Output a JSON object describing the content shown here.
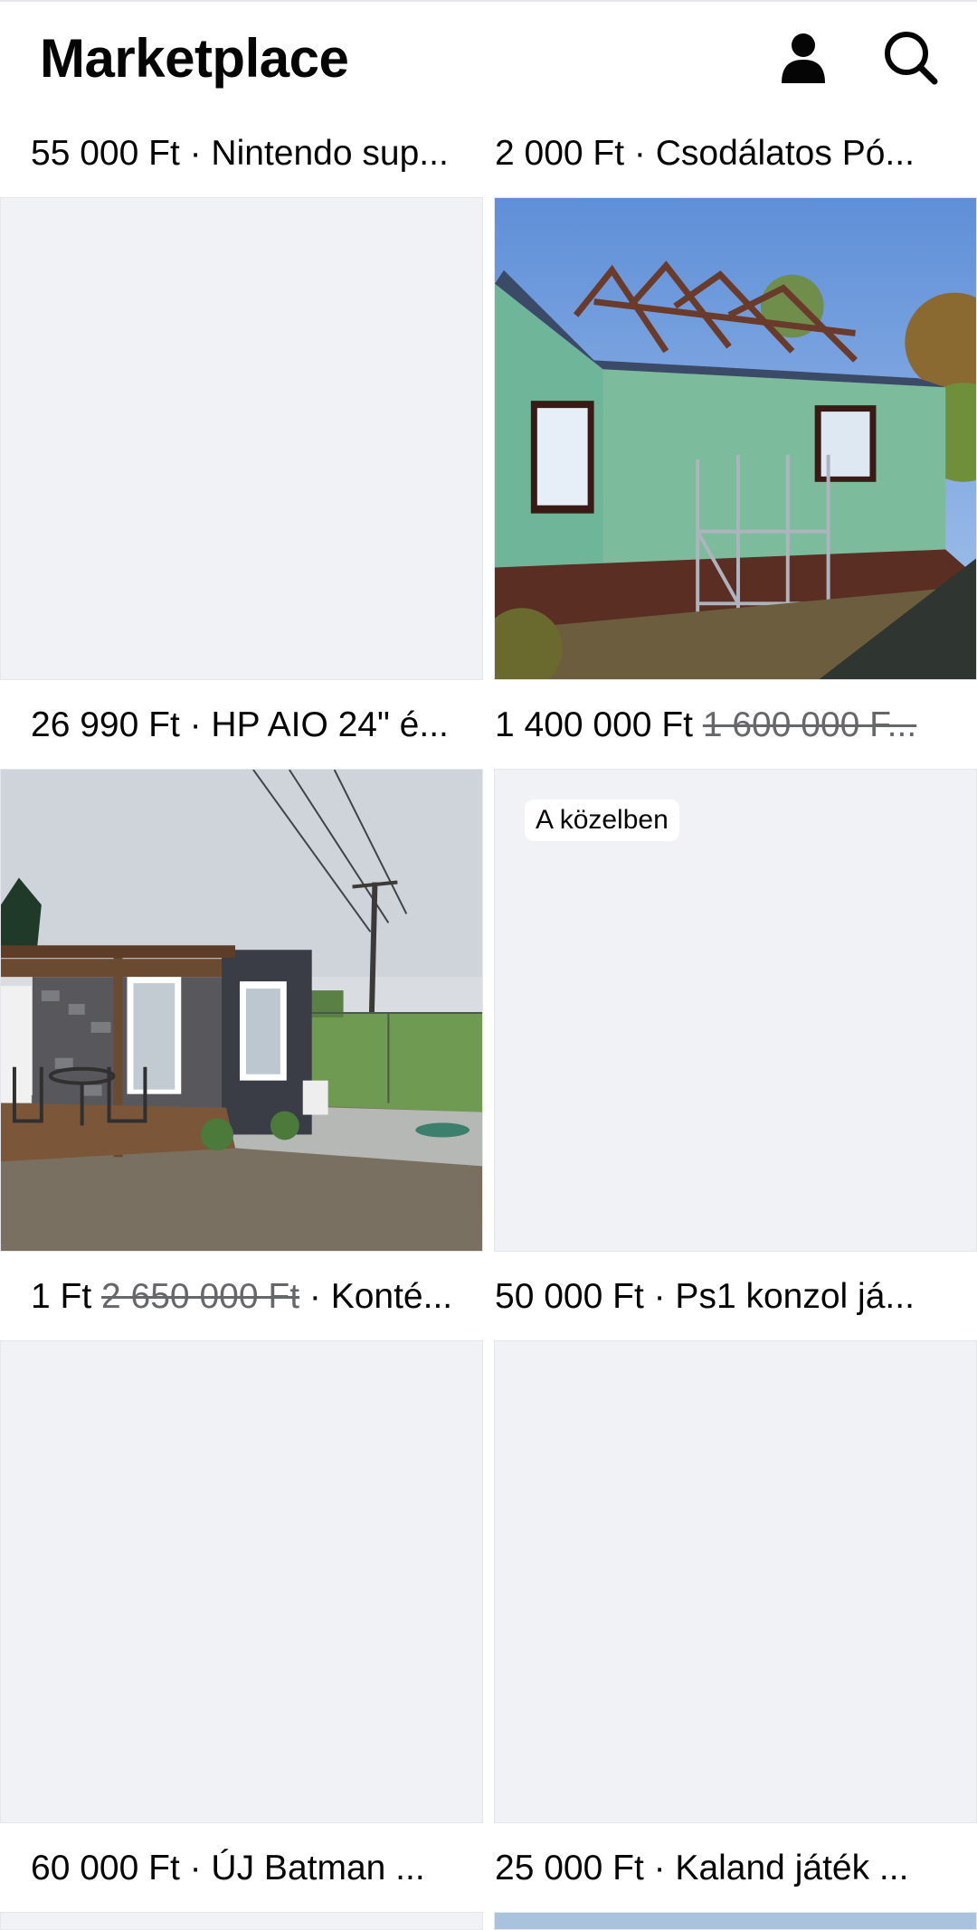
{
  "header": {
    "title": "Marketplace",
    "profile_icon": "person-icon",
    "search_icon": "search-icon"
  },
  "listings": [
    {
      "label": "55 000 Ft · Nintendo sup...",
      "price": "55 000 Ft",
      "title": "Nintendo sup..."
    },
    {
      "label": "2 000 Ft · Csodálatos Pó...",
      "price": "2 000 Ft",
      "title": "Csodálatos Pó..."
    },
    {
      "label": "26 990 Ft · HP AIO 24\" é...",
      "price": "26 990 Ft",
      "title": "HP AIO 24\" é..."
    },
    {
      "price": "1 400 000 Ft",
      "old_price": "1 600 000 F...",
      "title": ""
    },
    {
      "price": "1 Ft",
      "old_price": "2 650 000 Ft",
      "title": " · Konté..."
    },
    {
      "label": "50 000 Ft · Ps1 konzol já...",
      "price": "50 000 Ft",
      "title": "Ps1 konzol já..."
    },
    {
      "label": "60 000 Ft · ÚJ Batman ...",
      "price": "60 000 Ft",
      "title": "ÚJ Batman ..."
    },
    {
      "label": "25 000 Ft · Kaland játék ...",
      "price": "25 000 Ft",
      "title": "Kaland játék ..."
    }
  ],
  "badges": {
    "nearby": "A közelben"
  },
  "colors": {
    "placeholder": "#f0f2f5",
    "text": "#050505",
    "strike": "#65676b"
  }
}
